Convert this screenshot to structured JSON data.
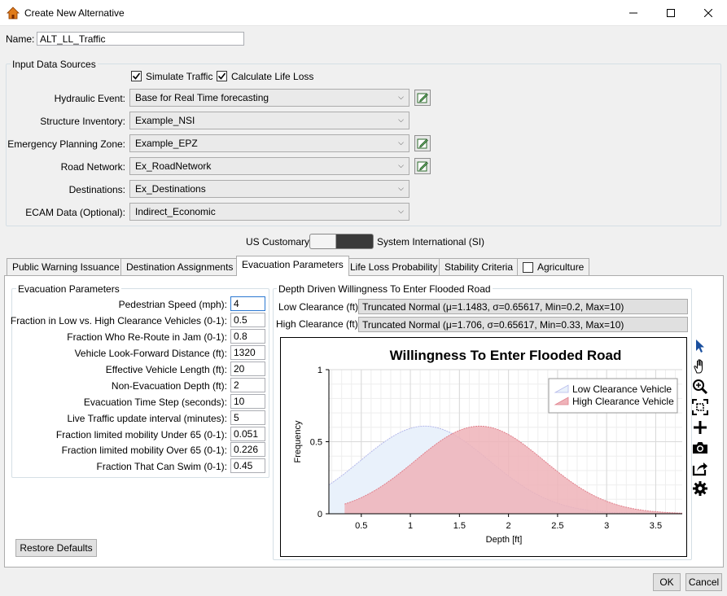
{
  "window": {
    "title": "Create New Alternative"
  },
  "name_field": {
    "label": "Name:",
    "value": "ALT_LL_Traffic"
  },
  "input_sources": {
    "group_label": "Input Data Sources",
    "simulate_traffic": {
      "label": "Simulate Traffic",
      "checked": true
    },
    "calculate_life_loss": {
      "label": "Calculate Life Loss",
      "checked": true
    },
    "rows": [
      {
        "label": "Hydraulic Event:",
        "value": "Base for Real Time forecasting",
        "edit": true
      },
      {
        "label": "Structure Inventory:",
        "value": "Example_NSI",
        "edit": false
      },
      {
        "label": "Emergency Planning Zone:",
        "value": "Example_EPZ",
        "edit": true
      },
      {
        "label": "Road Network:",
        "value": "Ex_RoadNetwork",
        "edit": true
      },
      {
        "label": "Destinations:",
        "value": "Ex_Destinations",
        "edit": false
      },
      {
        "label": "ECAM Data (Optional):",
        "value": "Indirect_Economic",
        "edit": false
      }
    ]
  },
  "units_toggle": {
    "left": "US Customary",
    "right": "System International (SI)"
  },
  "tabs": [
    {
      "label": "Public Warning Issuance"
    },
    {
      "label": "Destination Assignments"
    },
    {
      "label": "Evacuation Parameters"
    },
    {
      "label": "Life Loss Probability"
    },
    {
      "label": "Stability Criteria"
    },
    {
      "label": "Agriculture"
    }
  ],
  "evac_params": {
    "group_label": "Evacuation Parameters",
    "rows": [
      {
        "label": "Pedestrian Speed (mph):",
        "value": "4"
      },
      {
        "label": "Fraction in Low vs. High Clearance Vehicles (0-1):",
        "value": "0.5"
      },
      {
        "label": "Fraction Who Re-Route in Jam (0-1):",
        "value": "0.8"
      },
      {
        "label": "Vehicle Look-Forward Distance (ft):",
        "value": "1320"
      },
      {
        "label": "Effective Vehicle Length (ft):",
        "value": "20"
      },
      {
        "label": "Non-Evacuation Depth (ft):",
        "value": "2"
      },
      {
        "label": "Evacuation Time Step (seconds):",
        "value": "10"
      },
      {
        "label": "Live Traffic update interval (minutes):",
        "value": "5"
      },
      {
        "label": "Fraction limited mobility Under 65 (0-1):",
        "value": "0.051"
      },
      {
        "label": "Fraction limited mobility Over 65 (0-1):",
        "value": "0.226"
      },
      {
        "label": "Fraction That Can Swim (0-1):",
        "value": "0.45"
      }
    ],
    "restore_button": "Restore Defaults"
  },
  "willingness": {
    "group_label": "Depth Driven Willingness To Enter Flooded Road",
    "low_label": "Low Clearance (ft):",
    "low_value": "Truncated Normal (μ=1.1483, σ=0.65617, Min=0.2, Max=10)",
    "high_label": "High Clearance (ft):",
    "high_value": "Truncated Normal (μ=1.706, σ=0.65617, Min=0.33, Max=10)"
  },
  "chart_data": {
    "type": "area",
    "title": "Willingness To Enter Flooded Road",
    "xlabel": "Depth [ft]",
    "ylabel": "Frequency",
    "xlim": [
      0.17,
      3.77
    ],
    "ylim": [
      0,
      1
    ],
    "x_ticks": [
      "0.5",
      "1",
      "1.5",
      "2",
      "2.5",
      "3",
      "3.5"
    ],
    "y_ticks": [
      "0",
      "0.5",
      "1"
    ],
    "grid": true,
    "legend_position": "top-right",
    "series": [
      {
        "name": "Low Clearance Vehicle",
        "color": "#e9f1fb",
        "line": "#b4b8ea",
        "mean": 1.1483,
        "sd": 0.65617,
        "min": 0.2,
        "max": 10
      },
      {
        "name": "High Clearance Vehicle",
        "color": "#efb3b9",
        "line": "#e0808c",
        "mean": 1.706,
        "sd": 0.65617,
        "min": 0.33,
        "max": 10
      }
    ]
  },
  "chart_tools": [
    "pointer-icon",
    "pan-hand-icon",
    "zoom-in-icon",
    "zoom-extents-icon",
    "add-crosshair-icon",
    "camera-icon",
    "export-icon",
    "settings-gear-icon"
  ],
  "footer": {
    "ok": "OK",
    "cancel": "Cancel"
  }
}
